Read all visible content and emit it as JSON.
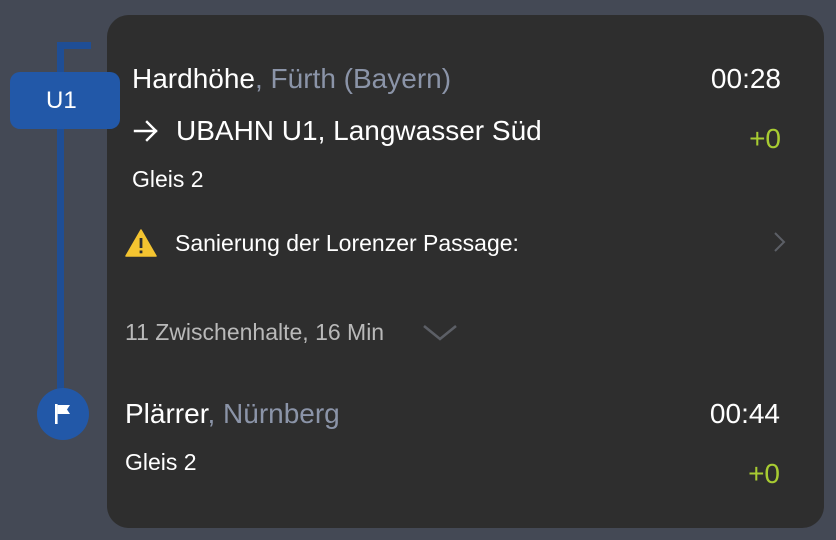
{
  "line": {
    "badge_label": "U1",
    "color": "#2258a8"
  },
  "origin": {
    "station": "Hardhöhe",
    "city": ", Fürth (Bayern)",
    "time": "00:28",
    "direction_label": "UBAHN U1, Langwasser Süd",
    "delay": "+0",
    "platform": "Gleis 2"
  },
  "notice": {
    "icon": "warning-icon",
    "text": "Sanierung der Lorenzer Passage:"
  },
  "stops": {
    "summary": "11 Zwischenhalte, 16 Min"
  },
  "destination": {
    "station": "Plärrer",
    "city": ", Nürnberg",
    "time": "00:44",
    "platform": "Gleis 2",
    "delay": "+0",
    "icon": "flag-icon"
  },
  "colors": {
    "background": "#444955",
    "card": "#2e2e2e",
    "muted_text": "#8b94a8",
    "delay_green": "#a8cc32",
    "warning_yellow": "#f4c430"
  }
}
